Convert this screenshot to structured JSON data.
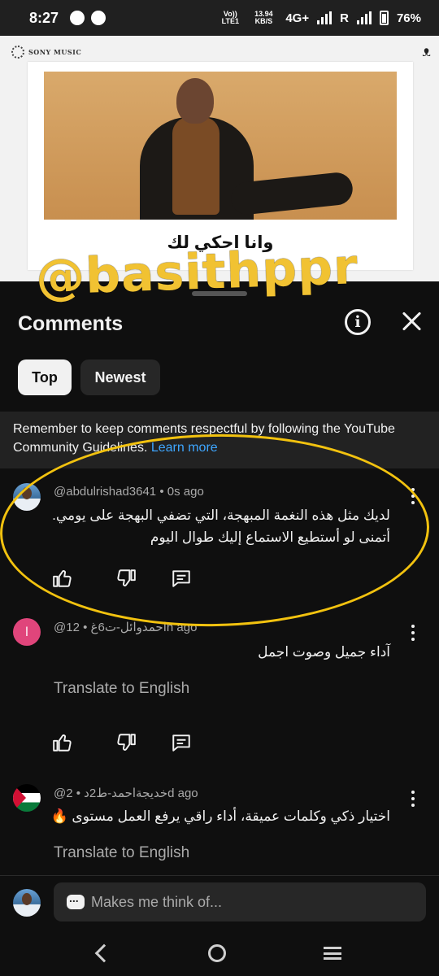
{
  "status_bar": {
    "time": "8:27",
    "volte": "Vo)) LTE1",
    "speed": "13.94 KB/S",
    "network": "4G+",
    "roaming": "R",
    "battery": "76%"
  },
  "video": {
    "label": "SONY MUSIC",
    "caption": "وانا احكي لك"
  },
  "watermark": "@basithppr",
  "comments_panel": {
    "title": "Comments",
    "chips": [
      {
        "label": "Top",
        "selected": true
      },
      {
        "label": "Newest",
        "selected": false
      }
    ],
    "guidelines_text": "Remember to keep comments respectful by following the YouTube Community Guidelines.",
    "guidelines_link": "Learn more",
    "comments": [
      {
        "author": "@abdulrishad3641",
        "age": "0s ago",
        "text_line1": "لديك مثل هذه النغمة المبهجة، التي تضفي البهجة على يومي.",
        "text_line2": "أتمنى لو أستطيع الاستماع إليك طوال اليوم",
        "avatar": "photo"
      },
      {
        "author": "@احمدوائل-ت6غ",
        "age": "12h ago",
        "text_line1": "آداء جميل وصوت اجمل",
        "translate": "Translate to English",
        "avatar_letter": "ا"
      },
      {
        "author": "@خديجةاحمد-ط2د",
        "age": "2d ago",
        "text_line1": "اختيار ذكي وكلمات عميقة، أداء راقي يرفع العمل مستوى 🔥",
        "translate": "Translate to English",
        "avatar": "flag"
      }
    ]
  },
  "composer": {
    "placeholder": "Makes me think of..."
  },
  "colors": {
    "background": "#0f0f0f",
    "link": "#3ea6ff",
    "highlight": "#f2c20f",
    "chip_selected": "#f1f1f1"
  },
  "icons": [
    "chat-bubble-icon",
    "facebook-icon",
    "signal-icon",
    "battery-icon",
    "info-icon",
    "close-icon",
    "like-icon",
    "dislike-icon",
    "reply-icon",
    "more-vert-icon",
    "back-icon",
    "home-icon",
    "recents-icon"
  ]
}
